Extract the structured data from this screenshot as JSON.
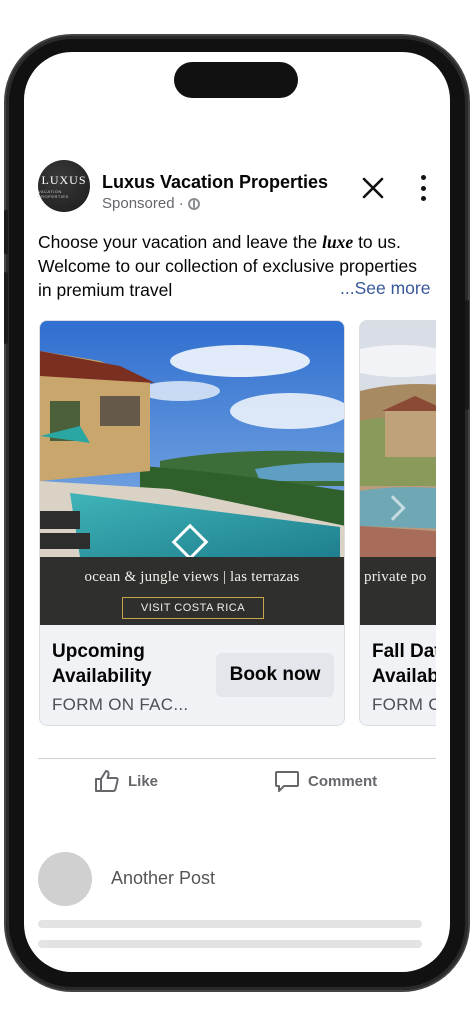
{
  "post": {
    "page_name": "Luxus Vacation Properties",
    "sponsored": "Sponsored ·",
    "avatar_text": "LUXUS",
    "avatar_subtext": "VACATION PROPERTIES",
    "text_before": "Choose your vacation and leave the ",
    "text_emphasis": "luxe",
    "text_after": " to us. Welcome to our collection of exclusive properties in premium travel",
    "see_more": "...See more"
  },
  "carousel": [
    {
      "banner_text": "ocean & jungle views | las terrazas",
      "banner_button": "VISIT COSTA RICA",
      "title": "Upcoming\nAvailability",
      "subtitle": "FORM ON FAC...",
      "button": "Book now"
    },
    {
      "banner_text": "private po",
      "title": "Fall Dat\nAvailab",
      "subtitle": "FORM C"
    }
  ],
  "actions": {
    "like": "Like",
    "comment": "Comment"
  },
  "next_post": {
    "title": "Another Post"
  },
  "colors": {
    "link": "#385898",
    "banner": "#2f2f2d",
    "gold": "#c7a64a",
    "card_footer": "#f0f2f5"
  }
}
